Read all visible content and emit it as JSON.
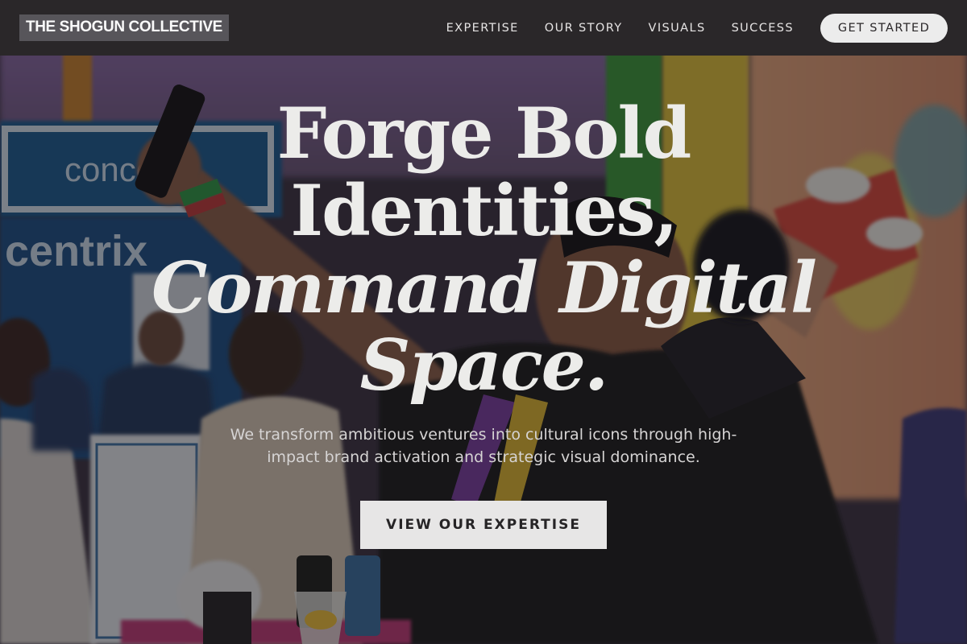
{
  "brand": {
    "name": "THE SHOGUN COLLECTIVE"
  },
  "nav": {
    "links": [
      "EXPERTISE",
      "OUR STORY",
      "VISUALS",
      "SUCCESS"
    ],
    "cta_label": "GET STARTED"
  },
  "hero": {
    "headline": {
      "line1": "Forge Bold",
      "line2": "Identities,",
      "line3": "Command Digital",
      "line4": "Space."
    },
    "subtext": "We transform ambitious ventures into cultural icons through high-impact brand activation and strategic visual dominance.",
    "primary_button_label": "VIEW OUR EXPERTISE",
    "background_photo_text": [
      "conce",
      "centrix"
    ]
  },
  "colors": {
    "nav_bg": "#2a2729",
    "logo_bg": "#57555a",
    "button_bg": "#e7e6e6",
    "headline_text": "#ececea"
  }
}
